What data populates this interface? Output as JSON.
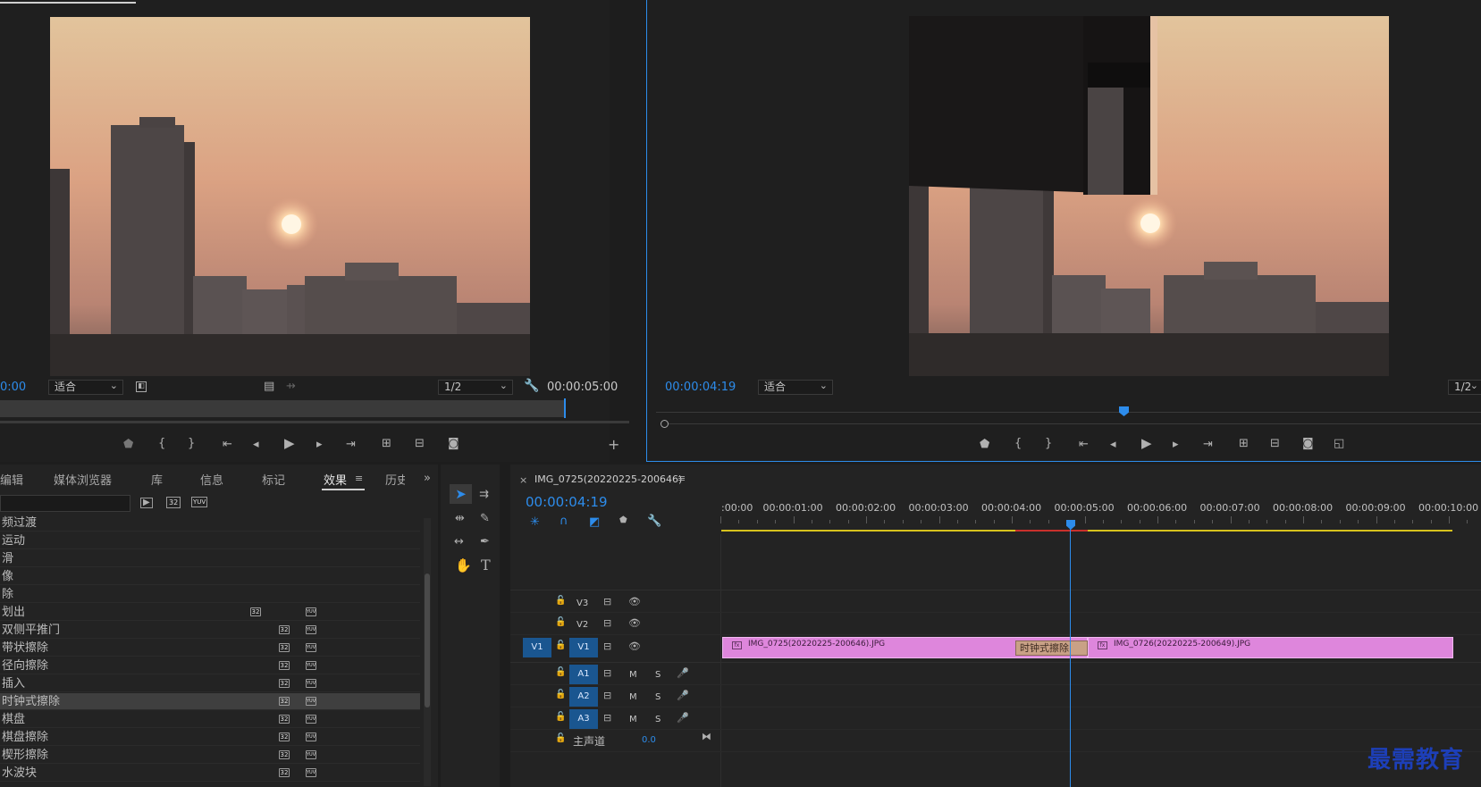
{
  "source_monitor": {
    "timecode": "0:00",
    "fit": "适合",
    "resolution": "1/2",
    "duration": "00:00:05:00"
  },
  "program_monitor": {
    "timecode": "00:00:04:19",
    "fit": "适合",
    "resolution": "1/2"
  },
  "effects_panel": {
    "tabs": [
      "编辑",
      "媒体浏览器",
      "库",
      "信息",
      "标记",
      "效果",
      "历史"
    ],
    "active_tab": "效果",
    "badges": [
      "32",
      "YUV"
    ],
    "items": [
      {
        "label": "频过渡",
        "badge32": false,
        "badgeYuv": false,
        "selected": false
      },
      {
        "label": "运动",
        "badge32": false,
        "badgeYuv": false,
        "selected": false
      },
      {
        "label": "滑",
        "badge32": false,
        "badgeYuv": false,
        "selected": false
      },
      {
        "label": "像",
        "badge32": false,
        "badgeYuv": false,
        "selected": false
      },
      {
        "label": "除",
        "badge32": false,
        "badgeYuv": false,
        "selected": false
      },
      {
        "label": "划出",
        "badge32": true,
        "badgeYuv": true,
        "selected": false
      },
      {
        "label": "双侧平推门",
        "badge32": true,
        "badgeYuv": true,
        "selected": false
      },
      {
        "label": "带状擦除",
        "badge32": true,
        "badgeYuv": true,
        "selected": false
      },
      {
        "label": "径向擦除",
        "badge32": true,
        "badgeYuv": true,
        "selected": false
      },
      {
        "label": "插入",
        "badge32": true,
        "badgeYuv": true,
        "selected": false
      },
      {
        "label": "时钟式擦除",
        "badge32": true,
        "badgeYuv": true,
        "selected": true
      },
      {
        "label": "棋盘",
        "badge32": true,
        "badgeYuv": true,
        "selected": false
      },
      {
        "label": "棋盘擦除",
        "badge32": true,
        "badgeYuv": true,
        "selected": false
      },
      {
        "label": "楔形擦除",
        "badge32": true,
        "badgeYuv": true,
        "selected": false
      },
      {
        "label": "水波块",
        "badge32": true,
        "badgeYuv": true,
        "selected": false
      }
    ]
  },
  "timeline": {
    "sequence_name": "IMG_0725(20220225-200646)",
    "timecode": "00:00:04:19",
    "ruler": [
      ":00:00",
      "00:00:01:00",
      "00:00:02:00",
      "00:00:03:00",
      "00:00:04:00",
      "00:00:05:00",
      "00:00:06:00",
      "00:00:07:00",
      "00:00:08:00",
      "00:00:09:00",
      "00:00:10:00"
    ],
    "video_tracks": [
      "V3",
      "V2",
      "V1"
    ],
    "audio_tracks": [
      "A1",
      "A2",
      "A3"
    ],
    "source_patch": "V1",
    "mute": "M",
    "solo": "S",
    "master_label": "主声道",
    "master_value": "0.0",
    "clips": [
      {
        "name": "IMG_0725(20220225-200646).JPG",
        "track": "V1"
      },
      {
        "name": "IMG_0726(20220225-200649).JPG",
        "track": "V1"
      }
    ],
    "transition_label": "时钟式擦除"
  },
  "watermark": "最需教育",
  "colors": {
    "accent_blue": "#2d8ceb",
    "clip_pink": "#de86dc",
    "work_area_yellow": "#d7c21d",
    "render_red": "#c9302c",
    "panel_bg": "#232323"
  }
}
